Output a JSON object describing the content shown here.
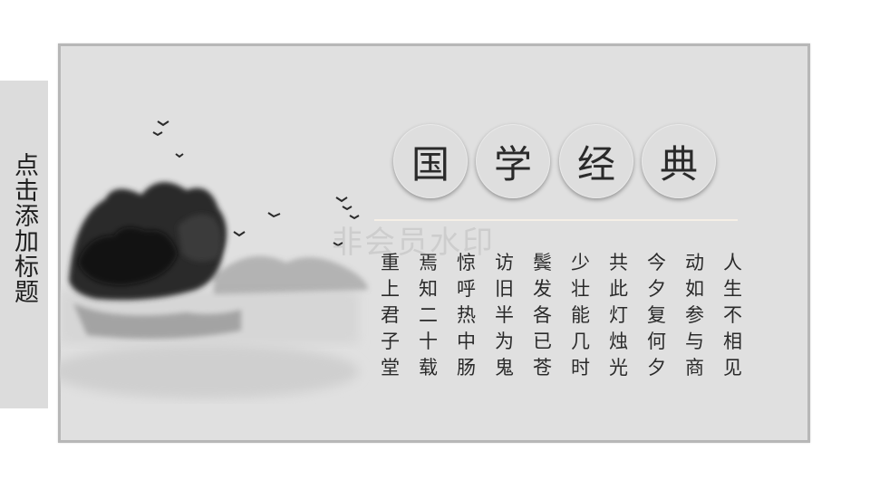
{
  "side_tab": {
    "title": "点击添加标题"
  },
  "main": {
    "title_chars": [
      "国",
      "学",
      "经",
      "典"
    ],
    "watermark": "非会员水印",
    "poem_columns": [
      "人生不相见",
      "动如参与商",
      "今夕复何夕",
      "共此灯烛光",
      "少壮能几时",
      "鬓发各已苍",
      "访旧半为鬼",
      "惊呼热中肠",
      "焉知二十载",
      "重上君子堂"
    ]
  }
}
